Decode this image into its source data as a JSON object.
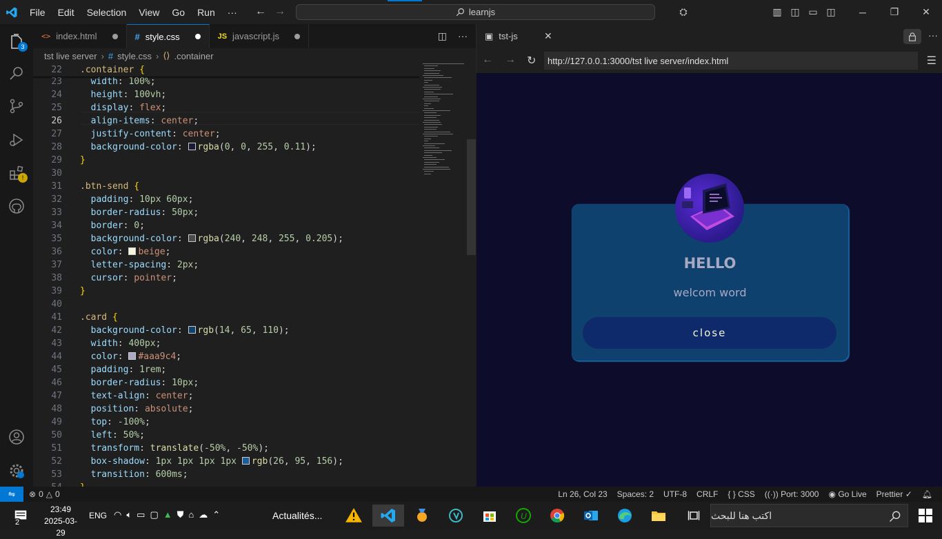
{
  "titlebar": {
    "menu": [
      "File",
      "Edit",
      "Selection",
      "View",
      "Go",
      "Run",
      "···"
    ],
    "search": "learnjs",
    "accent_color": "#0078d4"
  },
  "activity": {
    "explorer_badge": "3",
    "extensions_badge": "!"
  },
  "tabs": [
    {
      "label": "index.html",
      "icon": "html-icon",
      "active": false
    },
    {
      "label": "style.css",
      "icon": "css-icon",
      "active": true
    },
    {
      "label": "javascript.js",
      "icon": "js-icon",
      "active": false
    }
  ],
  "breadcrumb": [
    "tst live server",
    "style.css",
    ".container"
  ],
  "editor": {
    "current_line": 26,
    "lines": [
      {
        "n": 22,
        "html": "<span class='sel'>.container</span> <span class='br'>{</span>"
      },
      {
        "n": 23,
        "html": "  <span class='prop'>width</span>: <span class='num'>100%</span>;"
      },
      {
        "n": 24,
        "html": "  <span class='prop'>height</span>: <span class='num'>100vh</span>;"
      },
      {
        "n": 25,
        "html": "  <span class='prop'>display</span>: <span class='val'>flex</span>;"
      },
      {
        "n": 26,
        "html": "  <span class='prop'>align-items</span>: <span class='val'>center</span>;"
      },
      {
        "n": 27,
        "html": "  <span class='prop'>justify-content</span>: <span class='val'>center</span>;"
      },
      {
        "n": 28,
        "html": "  <span class='prop'>background-color</span>: <span class='swatch' style='background:rgba(0,0,255,0.11)'></span><span class='fn'>rgba</span>(<span class='num'>0</span>, <span class='num'>0</span>, <span class='num'>255</span>, <span class='num'>0.11</span>);"
      },
      {
        "n": 29,
        "html": "<span class='br'>}</span>"
      },
      {
        "n": 30,
        "html": ""
      },
      {
        "n": 31,
        "html": "<span class='sel'>.btn-send</span> <span class='br'>{</span>"
      },
      {
        "n": 32,
        "html": "  <span class='prop'>padding</span>: <span class='num'>10px</span> <span class='num'>60px</span>;"
      },
      {
        "n": 33,
        "html": "  <span class='prop'>border-radius</span>: <span class='num'>50px</span>;"
      },
      {
        "n": 34,
        "html": "  <span class='prop'>border</span>: <span class='num'>0</span>;"
      },
      {
        "n": 35,
        "html": "  <span class='prop'>background-color</span>: <span class='swatch' style='background:rgba(240,248,255,0.205)'></span><span class='fn'>rgba</span>(<span class='num'>240</span>, <span class='num'>248</span>, <span class='num'>255</span>, <span class='num'>0.205</span>);"
      },
      {
        "n": 36,
        "html": "  <span class='prop'>color</span>: <span class='swatch' style='background:beige'></span><span class='val'>beige</span>;"
      },
      {
        "n": 37,
        "html": "  <span class='prop'>letter-spacing</span>: <span class='num'>2px</span>;"
      },
      {
        "n": 38,
        "html": "  <span class='prop'>cursor</span>: <span class='val'>pointer</span>;"
      },
      {
        "n": 39,
        "html": "<span class='br'>}</span>"
      },
      {
        "n": 40,
        "html": ""
      },
      {
        "n": 41,
        "html": "<span class='sel'>.card</span> <span class='br'>{</span>"
      },
      {
        "n": 42,
        "html": "  <span class='prop'>background-color</span>: <span class='swatch' style='background:rgb(14,65,110)'></span><span class='fn'>rgb</span>(<span class='num'>14</span>, <span class='num'>65</span>, <span class='num'>110</span>);"
      },
      {
        "n": 43,
        "html": "  <span class='prop'>width</span>: <span class='num'>400px</span>;"
      },
      {
        "n": 44,
        "html": "  <span class='prop'>color</span>: <span class='swatch' style='background:#aaa9c4'></span><span class='val'>#aaa9c4</span>;"
      },
      {
        "n": 45,
        "html": "  <span class='prop'>padding</span>: <span class='num'>1rem</span>;"
      },
      {
        "n": 46,
        "html": "  <span class='prop'>border-radius</span>: <span class='num'>10px</span>;"
      },
      {
        "n": 47,
        "html": "  <span class='prop'>text-align</span>: <span class='val'>center</span>;"
      },
      {
        "n": 48,
        "html": "  <span class='prop'>position</span>: <span class='val'>absolute</span>;"
      },
      {
        "n": 49,
        "html": "  <span class='prop'>top</span>: <span class='num'>-100%</span>;"
      },
      {
        "n": 50,
        "html": "  <span class='prop'>left</span>: <span class='num'>50%</span>;"
      },
      {
        "n": 51,
        "html": "  <span class='prop'>transform</span>: <span class='fn'>translate</span>(<span class='num'>-50%</span>, <span class='num'>-50%</span>);"
      },
      {
        "n": 52,
        "html": "  <span class='prop'>box-shadow</span>: <span class='num'>1px</span> <span class='num'>1px</span> <span class='num'>1px</span> <span class='num'>1px</span> <span class='swatch' style='background:rgb(26,95,156)'></span><span class='fn'>rgb</span>(<span class='num'>26</span>, <span class='num'>95</span>, <span class='num'>156</span>);"
      },
      {
        "n": 53,
        "html": "  <span class='prop'>transition</span>: <span class='num'>600ms</span>;"
      },
      {
        "n": 54,
        "html": "<span class='br'>}</span>"
      }
    ]
  },
  "preview": {
    "tab_label": "tst-js",
    "url": "http://127.0.0.1:3000/tst live server/index.html",
    "card": {
      "title": "HELLO",
      "text": "welcom word",
      "button": "close"
    }
  },
  "statusbar": {
    "errors": "0",
    "warnings": "0",
    "position": "Ln 26, Col 23",
    "spaces": "Spaces: 2",
    "encoding": "UTF-8",
    "eol": "CRLF",
    "language": "CSS",
    "port": "Port: 3000",
    "golive": "Go Live",
    "prettier": "Prettier"
  },
  "taskbar": {
    "time": "23:49",
    "date": "2025-03-29",
    "lang": "ENG",
    "news": "Actualités...",
    "search_placeholder": "اكتب هنا للبحث",
    "notif_count": "2"
  }
}
